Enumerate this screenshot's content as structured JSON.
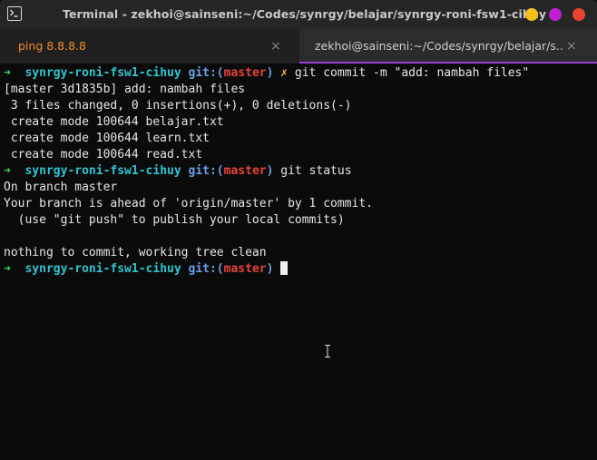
{
  "window": {
    "title": "Terminal - zekhoi@sainseni:~/Codes/synrgy/belajar/synrgy-roni-fsw1-cihuy",
    "icon": "terminal-icon",
    "controls": {
      "minimize_color": "#f5c018",
      "maximize_color": "#bf1fcf",
      "close_color": "#e8442f"
    }
  },
  "tabs": [
    {
      "label": "ping 8.8.8.8",
      "close": "×",
      "active": false,
      "color": "#f08a2a"
    },
    {
      "label": "zekhoi@sainseni:~/Codes/synrgy/belajar/s...",
      "close": "×",
      "active": true,
      "underline_color": "#9b3fd6"
    }
  ],
  "prompt": {
    "arrow": "➜",
    "dir": "synrgy-roni-fsw1-cihuy",
    "git_prefix": "git:(",
    "branch": "master",
    "git_suffix": ")",
    "dirty_mark": "✗"
  },
  "terminal": {
    "cmd1": "git commit -m \"add: nambah files\"",
    "out1": [
      "[master 3d1835b] add: nambah files",
      " 3 files changed, 0 insertions(+), 0 deletions(-)",
      " create mode 100644 belajar.txt",
      " create mode 100644 learn.txt",
      " create mode 100644 read.txt"
    ],
    "cmd2": "git status",
    "out2": [
      "On branch master",
      "Your branch is ahead of 'origin/master' by 1 commit.",
      "  (use \"git push\" to publish your local commits)",
      "",
      "nothing to commit, working tree clean"
    ]
  },
  "colors": {
    "arrow": "#3bd16f",
    "dir": "#2ec5d0",
    "git": "#6b9ee8",
    "branch": "#e8423a",
    "background": "#0b0b0b"
  }
}
